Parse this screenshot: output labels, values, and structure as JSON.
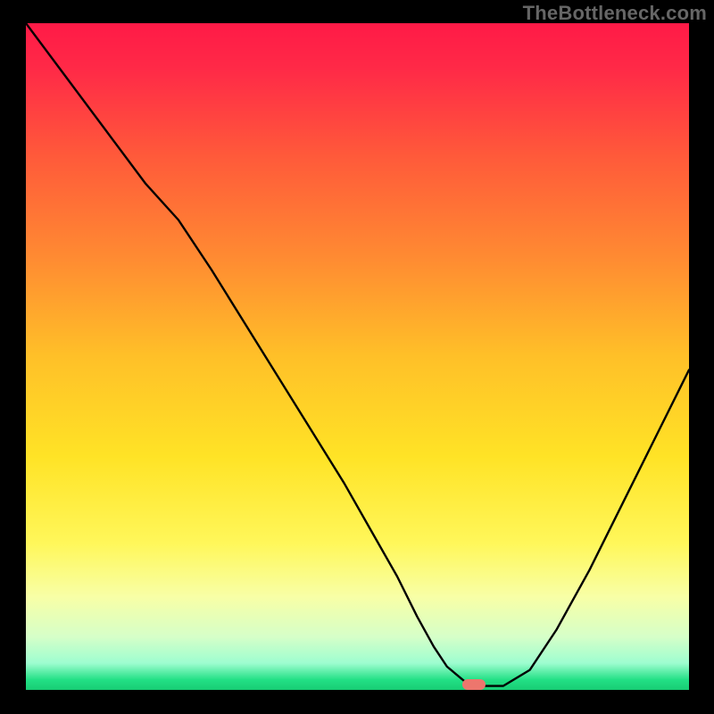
{
  "watermark": {
    "text": "TheBottleneck.com"
  },
  "chart_data": {
    "type": "line",
    "title": "",
    "xlabel": "",
    "ylabel": "",
    "xlim": [
      0,
      100
    ],
    "ylim": [
      0,
      100
    ],
    "grid": false,
    "legend": false,
    "gradient_stops": [
      {
        "offset": 0.0,
        "color": "#ff1a47"
      },
      {
        "offset": 0.07,
        "color": "#ff2a47"
      },
      {
        "offset": 0.2,
        "color": "#ff5a3a"
      },
      {
        "offset": 0.35,
        "color": "#ff8a32"
      },
      {
        "offset": 0.5,
        "color": "#ffc028"
      },
      {
        "offset": 0.65,
        "color": "#ffe326"
      },
      {
        "offset": 0.78,
        "color": "#fff75a"
      },
      {
        "offset": 0.86,
        "color": "#f8ffa6"
      },
      {
        "offset": 0.92,
        "color": "#d6ffc8"
      },
      {
        "offset": 0.96,
        "color": "#9dfdd0"
      },
      {
        "offset": 0.985,
        "color": "#22e085"
      },
      {
        "offset": 1.0,
        "color": "#18cc74"
      }
    ],
    "series": [
      {
        "name": "bottleneck-curve",
        "color": "#000000",
        "x": [
          0,
          6,
          12,
          18,
          23,
          28,
          33,
          38,
          43,
          48,
          52,
          56,
          59,
          61.5,
          63.5,
          66.5,
          69,
          72,
          76,
          80,
          85,
          90,
          95,
          100
        ],
        "y": [
          100,
          92,
          84,
          76,
          70.5,
          63,
          55,
          47,
          39,
          31,
          24,
          17,
          11,
          6.5,
          3.5,
          1.0,
          0.6,
          0.6,
          3.0,
          9,
          18,
          28,
          38,
          48
        ]
      }
    ],
    "marker": {
      "x": 67.5,
      "y": 0.8,
      "color": "#ed766d"
    }
  }
}
